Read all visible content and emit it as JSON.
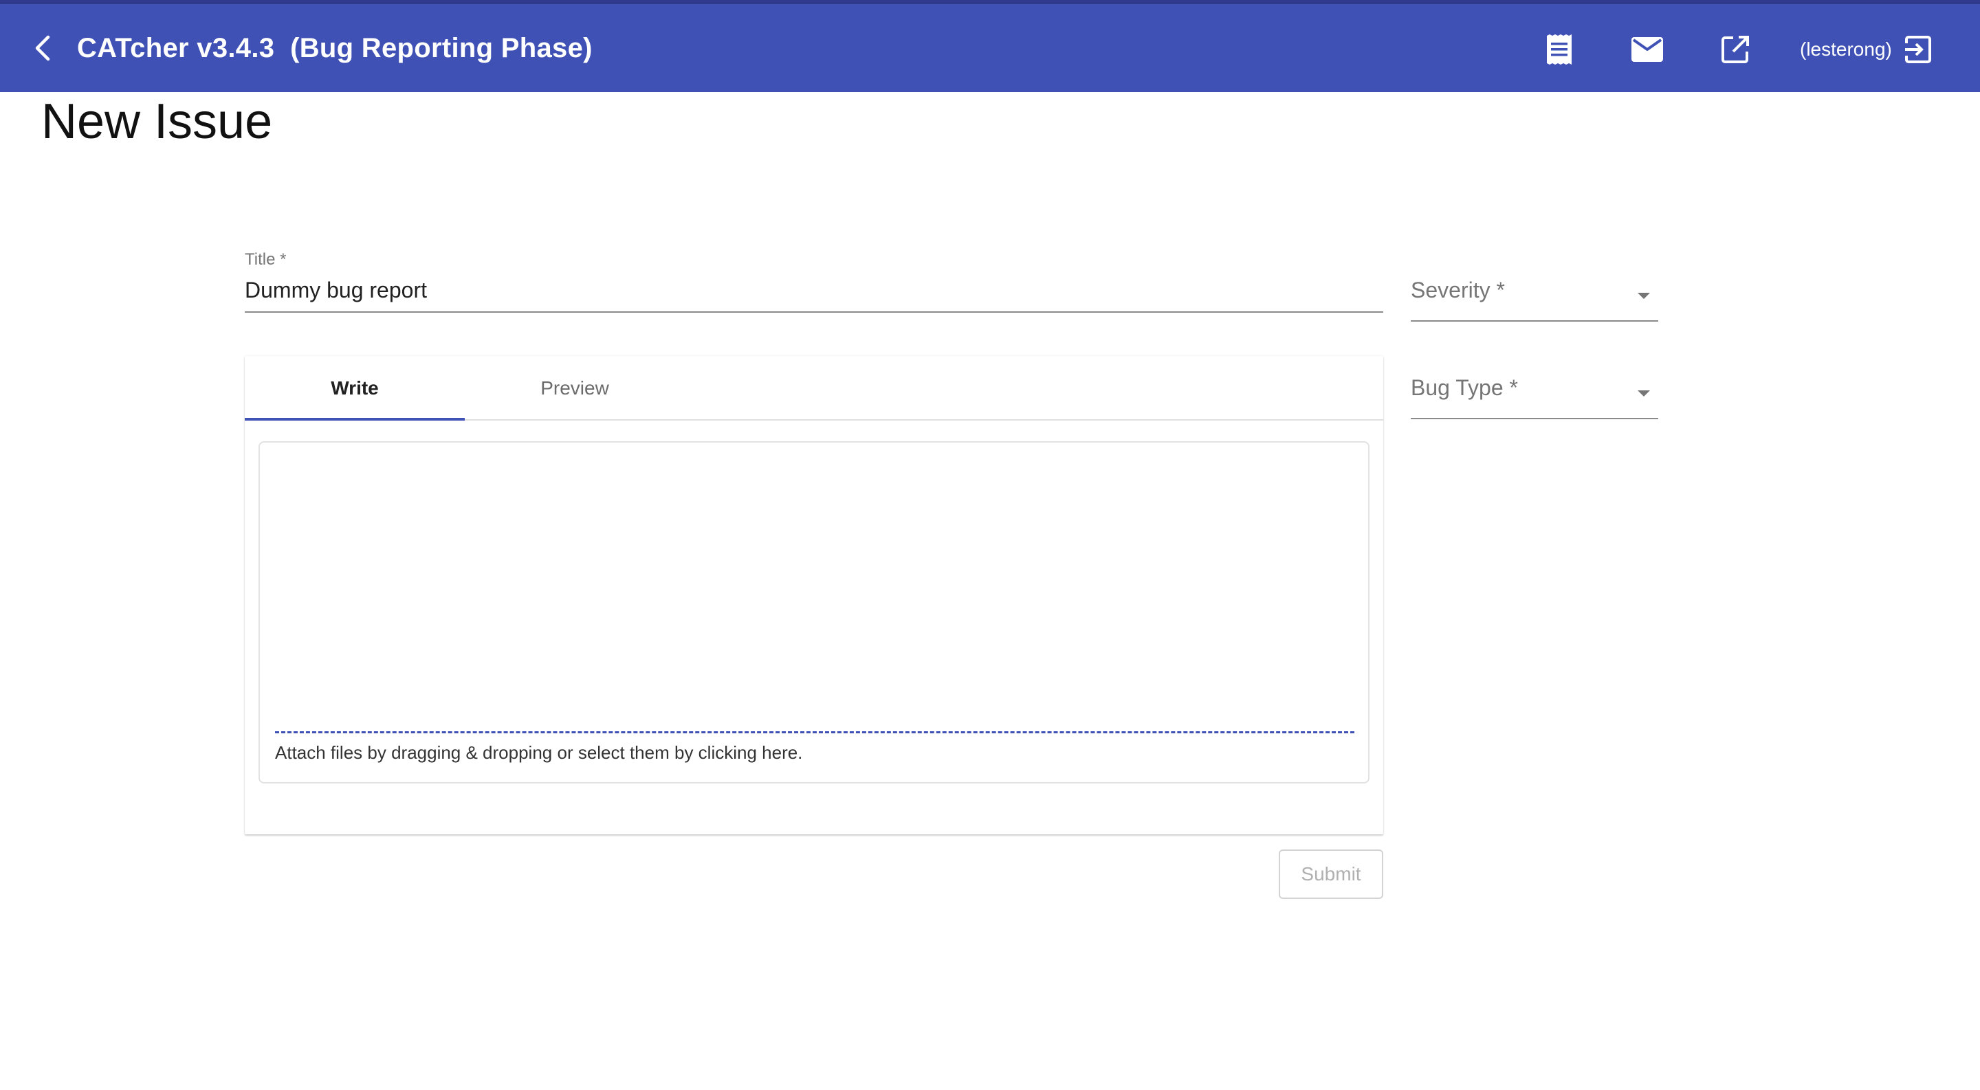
{
  "header": {
    "title": "CATcher v3.4.3  (Bug Reporting Phase)",
    "username": "(lesterong)",
    "icons": [
      "back-chevron-icon",
      "issue-list-icon",
      "mail-icon",
      "open-external-icon",
      "logout-icon"
    ],
    "colors": {
      "toolbar": "#3f51b5",
      "accent": "#3f51b5"
    }
  },
  "page": {
    "title": "New Issue"
  },
  "form": {
    "title_label": "Title *",
    "title_value": "Dummy bug report",
    "severity_label": "Severity *",
    "bug_type_label": "Bug Type *",
    "tabs": [
      {
        "label": "Write",
        "active": true
      },
      {
        "label": "Preview",
        "active": false
      }
    ],
    "description_value": "",
    "attach_hint": "Attach files by dragging & dropping or select them by clicking here.",
    "submit_label": "Submit",
    "submit_disabled": true
  }
}
